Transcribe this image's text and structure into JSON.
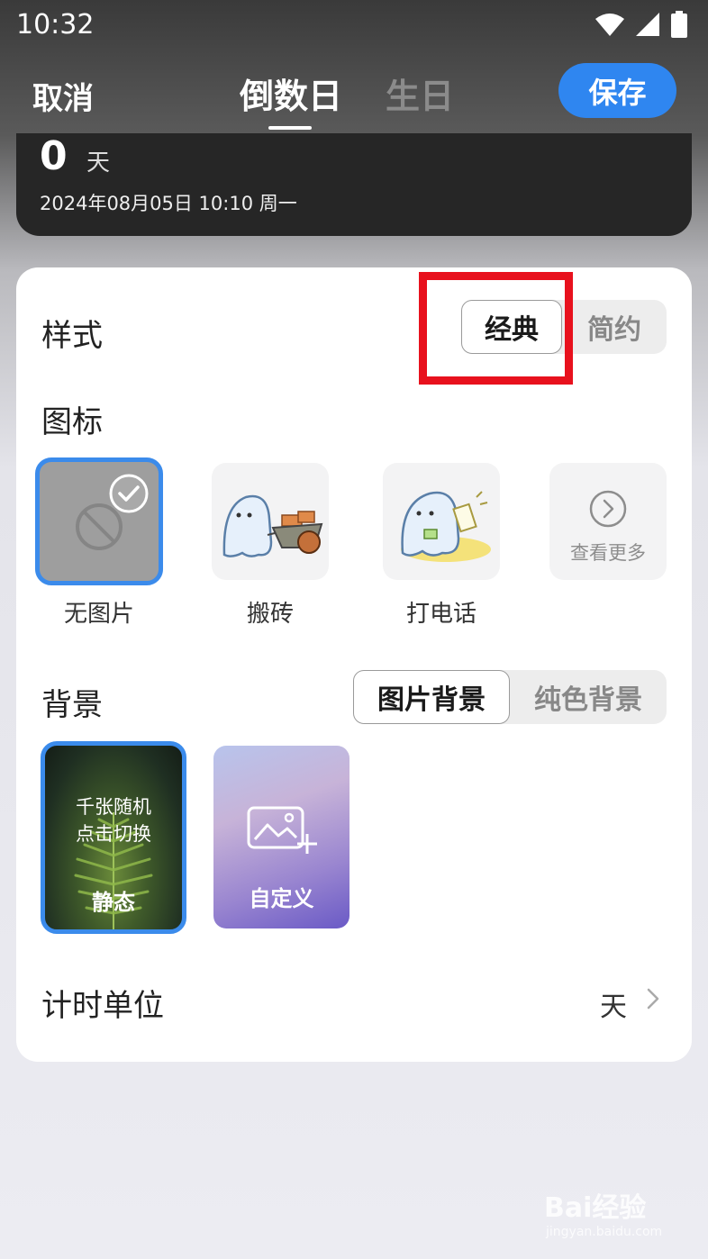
{
  "status_bar": {
    "time": "10:32",
    "icons": [
      "wifi-icon",
      "signal-icon",
      "battery-icon"
    ]
  },
  "nav": {
    "cancel": "取消",
    "tabs": [
      {
        "label": "倒数日",
        "active": true
      },
      {
        "label": "生日",
        "active": false
      }
    ],
    "save": "保存"
  },
  "preview": {
    "days": "0",
    "unit": "天",
    "date": "2024年08月05日  10:10  周一"
  },
  "style_section": {
    "label": "样式",
    "options": [
      {
        "label": "经典",
        "active": true
      },
      {
        "label": "简约",
        "active": false
      }
    ]
  },
  "icon_section": {
    "label": "图标",
    "items": [
      {
        "label": "无图片",
        "selected": true,
        "icon": "no-image-icon"
      },
      {
        "label": "搬砖",
        "selected": false,
        "icon": "ghost-cart-icon"
      },
      {
        "label": "打电话",
        "selected": false,
        "icon": "ghost-phone-icon"
      }
    ],
    "more": "查看更多"
  },
  "background_section": {
    "label": "背景",
    "options": [
      {
        "label": "图片背景",
        "active": true
      },
      {
        "label": "纯色背景",
        "active": false
      }
    ],
    "items": [
      {
        "line1": "千张随机",
        "line2": "点击切换",
        "title": "静态",
        "selected": true
      },
      {
        "title": "自定义",
        "selected": false,
        "icon": "add-image-icon"
      }
    ]
  },
  "timer_unit": {
    "label": "计时单位",
    "value": "天"
  },
  "watermark": {
    "text": "Bai经验",
    "sub": "jingyan.baidu.com"
  },
  "colors": {
    "accent": "#2f86f0",
    "selected_border": "#3b8beb",
    "highlight": "#e8111d"
  }
}
